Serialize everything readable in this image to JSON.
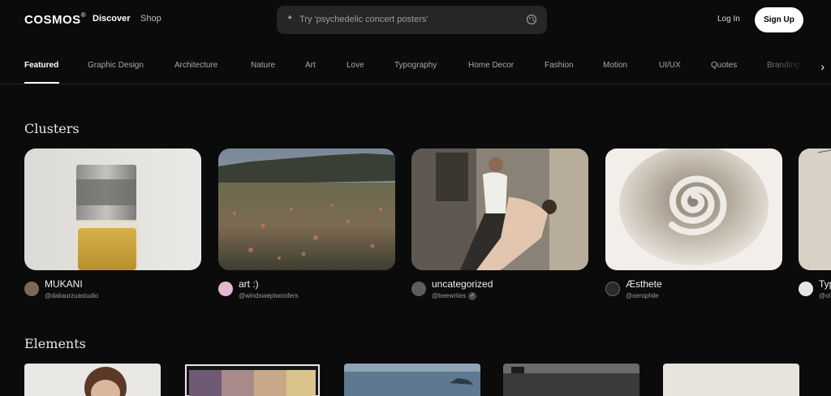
{
  "header": {
    "logo": "COSMOS",
    "logo_mark": "®",
    "nav": [
      "Discover",
      "Shop"
    ],
    "search_placeholder": "Try 'psychedelic concert posters'",
    "login": "Log In",
    "signup": "Sign Up"
  },
  "categories": [
    "Featured",
    "Graphic Design",
    "Architecture",
    "Nature",
    "Art",
    "Love",
    "Typography",
    "Home Decor",
    "Fashion",
    "Motion",
    "UI/UX",
    "Quotes",
    "Branding"
  ],
  "active_category": "Featured",
  "sections": {
    "clusters": "Clusters",
    "elements": "Elements"
  },
  "clusters": [
    {
      "name": "MUKANI",
      "handle": "@daliaurzuastudio",
      "verified": false,
      "image": "perfume-bottle"
    },
    {
      "name": "art :)",
      "handle": "@windsweptwoofers",
      "verified": false,
      "image": "blurred-meadow"
    },
    {
      "name": "uncategorized",
      "handle": "@beewrites",
      "verified": true,
      "image": "dancing-couple"
    },
    {
      "name": "Æsthete",
      "handle": "@xerophile",
      "verified": false,
      "image": "spiral"
    },
    {
      "name": "Typ",
      "handle": "@ol",
      "verified": false,
      "image": "partial"
    }
  ],
  "colors": {
    "background": "#0b0b0b",
    "search_bg": "#262626",
    "signup_bg": "#ffffff",
    "muted_text": "#a9a9a9"
  }
}
